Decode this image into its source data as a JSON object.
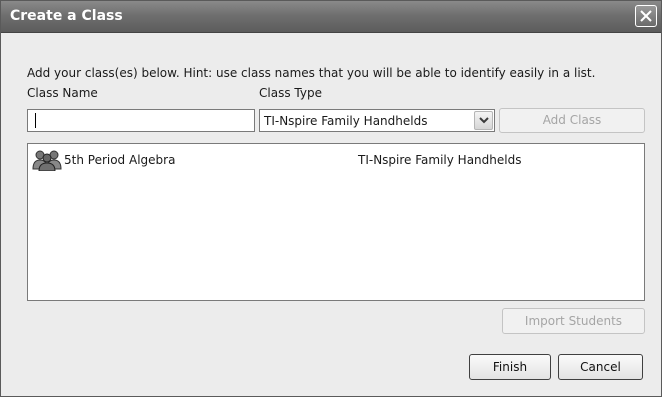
{
  "window": {
    "title": "Create a Class",
    "close_icon": "close-icon"
  },
  "form": {
    "hint": "Add your class(es) below.  Hint: use class names that you will be able to identify easily in a list.",
    "class_name_label": "Class Name",
    "class_type_label": "Class Type",
    "class_name_value": "",
    "class_type_selected": "TI-Nspire Family Handhelds",
    "add_class_label": "Add Class"
  },
  "classes": [
    {
      "icon": "group-icon",
      "name": "5th Period Algebra",
      "type": "TI-Nspire Family Handhelds"
    }
  ],
  "buttons": {
    "import_students": "Import Students",
    "finish": "Finish",
    "cancel": "Cancel"
  },
  "colors": {
    "titlebar": "#6f6f6f",
    "window_bg": "#ececec",
    "disabled_text": "#a5a5a5"
  }
}
